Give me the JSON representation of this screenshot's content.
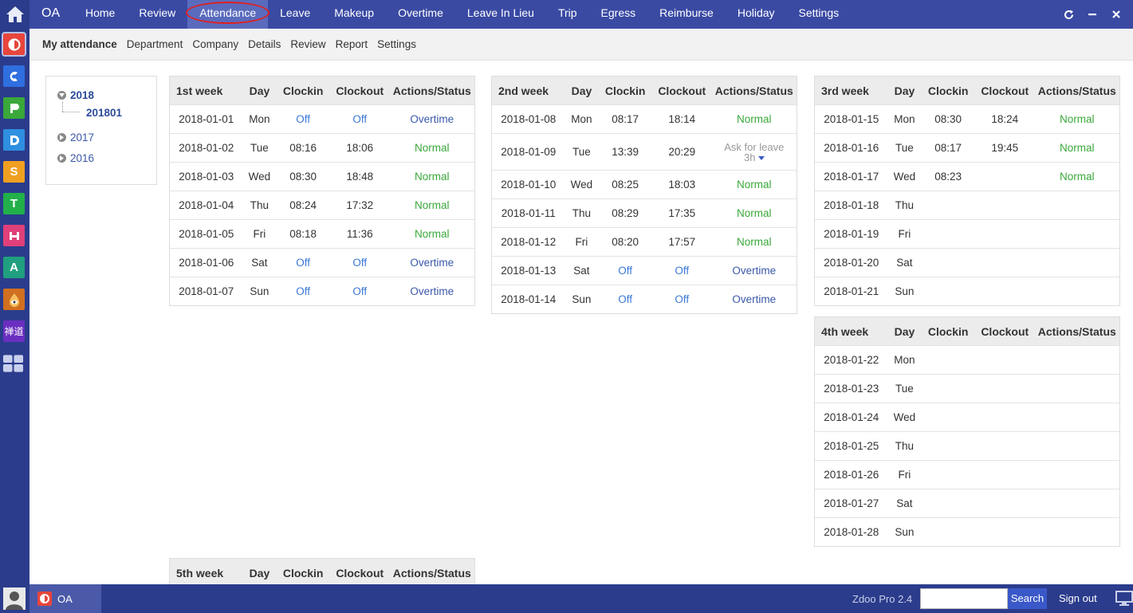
{
  "topbar": {
    "brand": "OA",
    "nav": [
      "Home",
      "Review",
      "Attendance",
      "Leave",
      "Makeup",
      "Overtime",
      "Leave In Lieu",
      "Trip",
      "Egress",
      "Reimburse",
      "Holiday",
      "Settings"
    ],
    "active": "Attendance"
  },
  "subbar": [
    "My attendance",
    "Department",
    "Company",
    "Details",
    "Review",
    "Report",
    "Settings"
  ],
  "tree": {
    "years": [
      "2018",
      "2017",
      "2016"
    ],
    "open_month": "201801"
  },
  "weeks": [
    {
      "title": "1st week",
      "headers": [
        "Day",
        "Clockin",
        "Clockout",
        "Actions/Status"
      ],
      "rows": [
        {
          "date": "2018-01-01",
          "day": "Mon",
          "in": "Off",
          "out": "Off",
          "status": "Overtime"
        },
        {
          "date": "2018-01-02",
          "day": "Tue",
          "in": "08:16",
          "out": "18:06",
          "status": "Normal"
        },
        {
          "date": "2018-01-03",
          "day": "Wed",
          "in": "08:30",
          "out": "18:48",
          "status": "Normal"
        },
        {
          "date": "2018-01-04",
          "day": "Thu",
          "in": "08:24",
          "out": "17:32",
          "status": "Normal"
        },
        {
          "date": "2018-01-05",
          "day": "Fri",
          "in": "08:18",
          "out": "11:36",
          "status": "Normal"
        },
        {
          "date": "2018-01-06",
          "day": "Sat",
          "in": "Off",
          "out": "Off",
          "status": "Overtime"
        },
        {
          "date": "2018-01-07",
          "day": "Sun",
          "in": "Off",
          "out": "Off",
          "status": "Overtime"
        }
      ]
    },
    {
      "title": "2nd week",
      "headers": [
        "Day",
        "Clockin",
        "Clockout",
        "Actions/Status"
      ],
      "rows": [
        {
          "date": "2018-01-08",
          "day": "Mon",
          "in": "08:17",
          "out": "18:14",
          "status": "Normal"
        },
        {
          "date": "2018-01-09",
          "day": "Tue",
          "in": "13:39",
          "out": "20:29",
          "status": "Ask for leave",
          "status_sub": "3h"
        },
        {
          "date": "2018-01-10",
          "day": "Wed",
          "in": "08:25",
          "out": "18:03",
          "status": "Normal"
        },
        {
          "date": "2018-01-11",
          "day": "Thu",
          "in": "08:29",
          "out": "17:35",
          "status": "Normal"
        },
        {
          "date": "2018-01-12",
          "day": "Fri",
          "in": "08:20",
          "out": "17:57",
          "status": "Normal"
        },
        {
          "date": "2018-01-13",
          "day": "Sat",
          "in": "Off",
          "out": "Off",
          "status": "Overtime"
        },
        {
          "date": "2018-01-14",
          "day": "Sun",
          "in": "Off",
          "out": "Off",
          "status": "Overtime"
        }
      ]
    },
    {
      "title": "3rd week",
      "headers": [
        "Day",
        "Clockin",
        "Clockout",
        "Actions/Status"
      ],
      "rows": [
        {
          "date": "2018-01-15",
          "day": "Mon",
          "in": "08:30",
          "out": "18:24",
          "status": "Normal"
        },
        {
          "date": "2018-01-16",
          "day": "Tue",
          "in": "08:17",
          "out": "19:45",
          "status": "Normal"
        },
        {
          "date": "2018-01-17",
          "day": "Wed",
          "in": "08:23",
          "out": "",
          "status": "Normal"
        },
        {
          "date": "2018-01-18",
          "day": "Thu",
          "in": "",
          "out": "",
          "status": ""
        },
        {
          "date": "2018-01-19",
          "day": "Fri",
          "in": "",
          "out": "",
          "status": ""
        },
        {
          "date": "2018-01-20",
          "day": "Sat",
          "in": "",
          "out": "",
          "status": ""
        },
        {
          "date": "2018-01-21",
          "day": "Sun",
          "in": "",
          "out": "",
          "status": ""
        }
      ]
    },
    {
      "title": "4th week",
      "headers": [
        "Day",
        "Clockin",
        "Clockout",
        "Actions/Status"
      ],
      "rows": [
        {
          "date": "2018-01-22",
          "day": "Mon",
          "in": "",
          "out": "",
          "status": ""
        },
        {
          "date": "2018-01-23",
          "day": "Tue",
          "in": "",
          "out": "",
          "status": ""
        },
        {
          "date": "2018-01-24",
          "day": "Wed",
          "in": "",
          "out": "",
          "status": ""
        },
        {
          "date": "2018-01-25",
          "day": "Thu",
          "in": "",
          "out": "",
          "status": ""
        },
        {
          "date": "2018-01-26",
          "day": "Fri",
          "in": "",
          "out": "",
          "status": ""
        },
        {
          "date": "2018-01-27",
          "day": "Sat",
          "in": "",
          "out": "",
          "status": ""
        },
        {
          "date": "2018-01-28",
          "day": "Sun",
          "in": "",
          "out": "",
          "status": ""
        }
      ]
    },
    {
      "title": "5th week",
      "headers": [
        "Day",
        "Clockin",
        "Clockout",
        "Actions/Status"
      ],
      "rows": []
    }
  ],
  "dock": {
    "apps": [
      {
        "icon": "oa-app-icon",
        "color": "#e8453c"
      },
      {
        "icon": "crm-app-icon",
        "color": "#2f6fe0"
      },
      {
        "icon": "project-app-icon",
        "color": "#3aa83a"
      },
      {
        "icon": "doc-app-icon",
        "color": "#2f8fe0"
      },
      {
        "icon": "cash-app-icon",
        "color": "#f0a020",
        "glyph": "S"
      },
      {
        "icon": "team-app-icon",
        "color": "#22b04a",
        "glyph": "T"
      },
      {
        "icon": "hotel-app-icon",
        "color": "#e0407a"
      },
      {
        "icon": "app-a-icon",
        "color": "#20a080",
        "glyph": "A"
      },
      {
        "icon": "eye-app-icon",
        "color": "#d07020"
      },
      {
        "icon": "chandao-app-icon",
        "color": "#6a2fc0",
        "glyph": "禅道"
      }
    ]
  },
  "footer": {
    "task_label": "OA",
    "version": "Zdoo Pro 2.4",
    "search_placeholder": "",
    "search_label": "Search",
    "signout_label": "Sign out"
  }
}
